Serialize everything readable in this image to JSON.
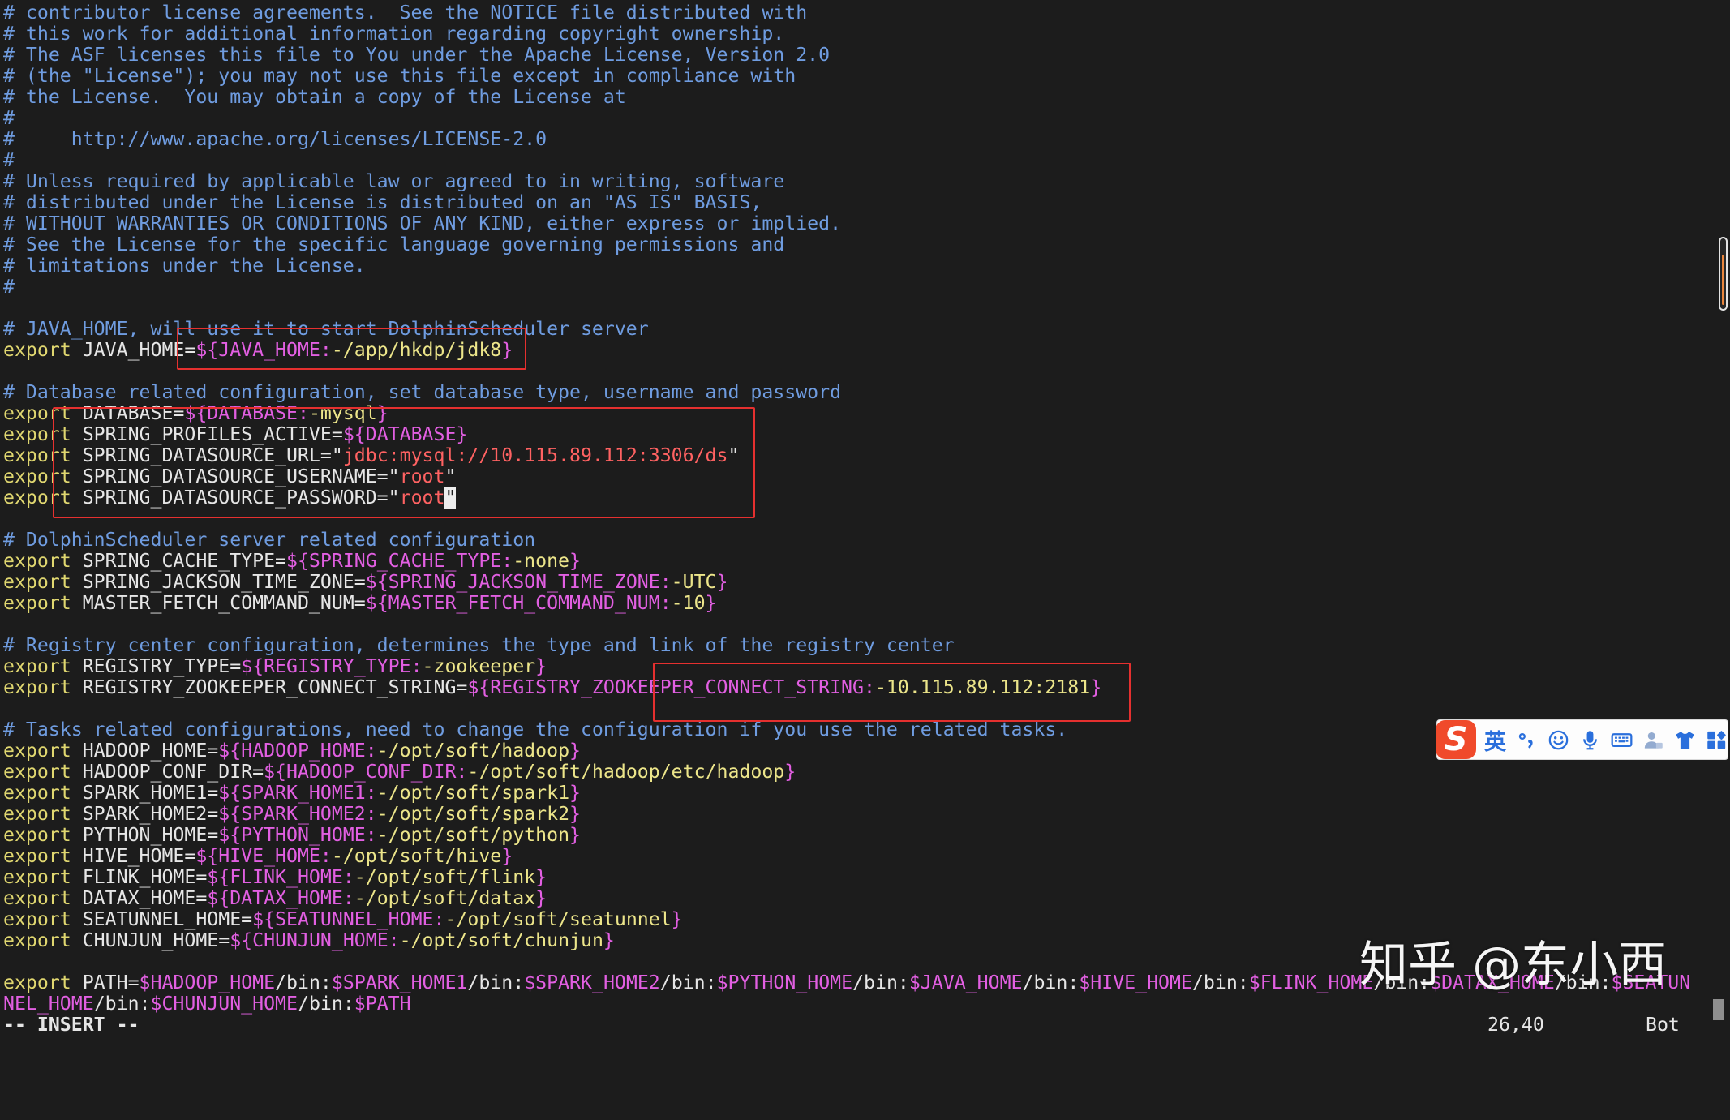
{
  "colors": {
    "background": "#1c1c1c",
    "comment": "#6f9ce0",
    "keyword": "#e0d770",
    "plain": "#e6e6e6",
    "deref": "#e25fe2",
    "default": "#ece58a",
    "string": "#ff6262",
    "cursor": "#ededed",
    "annotation": "#e5302f",
    "ime_icon": "#2a6fdc",
    "ime_logo": "#f04a2b",
    "scrollbar_accent": "#e9853c"
  },
  "editor": {
    "lines": [
      [
        [
          "#6f9ce0",
          "# contributor license agreements.  See the NOTICE file distributed with"
        ]
      ],
      [
        [
          "#6f9ce0",
          "# this work for additional information regarding copyright ownership."
        ]
      ],
      [
        [
          "#6f9ce0",
          "# The ASF licenses this file to You under the Apache License, Version 2.0"
        ]
      ],
      [
        [
          "#6f9ce0",
          "# (the \"License\"); you may not use this file except in compliance with"
        ]
      ],
      [
        [
          "#6f9ce0",
          "# the License.  You may obtain a copy of the License at"
        ]
      ],
      [
        [
          "#6f9ce0",
          "#"
        ]
      ],
      [
        [
          "#6f9ce0",
          "#     http://www.apache.org/licenses/LICENSE-2.0"
        ]
      ],
      [
        [
          "#6f9ce0",
          "#"
        ]
      ],
      [
        [
          "#6f9ce0",
          "# Unless required by applicable law or agreed to in writing, software"
        ]
      ],
      [
        [
          "#6f9ce0",
          "# distributed under the License is distributed on an \"AS IS\" BASIS,"
        ]
      ],
      [
        [
          "#6f9ce0",
          "# WITHOUT WARRANTIES OR CONDITIONS OF ANY KIND, either express or implied."
        ]
      ],
      [
        [
          "#6f9ce0",
          "# See the License for the specific language governing permissions and"
        ]
      ],
      [
        [
          "#6f9ce0",
          "# limitations under the License."
        ]
      ],
      [
        [
          "#6f9ce0",
          "#"
        ]
      ],
      [],
      [
        [
          "#6f9ce0",
          "# JAVA_HOME, will use it to start DolphinScheduler server"
        ]
      ],
      [
        [
          "#e0d770",
          "export"
        ],
        [
          "#e6e6e6",
          " JAVA_HOME="
        ],
        [
          "#e25fe2",
          "${JAVA_HOME:"
        ],
        [
          "#ece58a",
          "-/app/hkdp/jdk8"
        ],
        [
          "#e25fe2",
          "}"
        ]
      ],
      [],
      [
        [
          "#6f9ce0",
          "# Database related configuration, set database type, username and password"
        ]
      ],
      [
        [
          "#e0d770",
          "export"
        ],
        [
          "#e6e6e6",
          " DATABASE="
        ],
        [
          "#e25fe2",
          "${DATABASE:"
        ],
        [
          "#ece58a",
          "-mysql"
        ],
        [
          "#e25fe2",
          "}"
        ]
      ],
      [
        [
          "#e0d770",
          "export"
        ],
        [
          "#e6e6e6",
          " SPRING_PROFILES_ACTIVE="
        ],
        [
          "#e25fe2",
          "${DATABASE}"
        ]
      ],
      [
        [
          "#e0d770",
          "export"
        ],
        [
          "#e6e6e6",
          " SPRING_DATASOURCE_URL="
        ],
        [
          "#e6e6e6",
          "\""
        ],
        [
          "#ff6262",
          "jdbc:mysql://10.115.89.112:3306/ds"
        ],
        [
          "#e6e6e6",
          "\""
        ]
      ],
      [
        [
          "#e0d770",
          "export"
        ],
        [
          "#e6e6e6",
          " SPRING_DATASOURCE_USERNAME="
        ],
        [
          "#e6e6e6",
          "\""
        ],
        [
          "#ff6262",
          "root"
        ],
        [
          "#e6e6e6",
          "\""
        ]
      ],
      [
        [
          "#e0d770",
          "export"
        ],
        [
          "#e6e6e6",
          " SPRING_DATASOURCE_PASSWORD="
        ],
        [
          "#e6e6e6",
          "\""
        ],
        [
          "#ff6262",
          "root"
        ],
        [
          "#ededed",
          "\""
        ]
      ],
      [],
      [
        [
          "#6f9ce0",
          "# DolphinScheduler server related configuration"
        ]
      ],
      [
        [
          "#e0d770",
          "export"
        ],
        [
          "#e6e6e6",
          " SPRING_CACHE_TYPE="
        ],
        [
          "#e25fe2",
          "${SPRING_CACHE_TYPE:"
        ],
        [
          "#ece58a",
          "-none"
        ],
        [
          "#e25fe2",
          "}"
        ]
      ],
      [
        [
          "#e0d770",
          "export"
        ],
        [
          "#e6e6e6",
          " SPRING_JACKSON_TIME_ZONE="
        ],
        [
          "#e25fe2",
          "${SPRING_JACKSON_TIME_ZONE:"
        ],
        [
          "#ece58a",
          "-UTC"
        ],
        [
          "#e25fe2",
          "}"
        ]
      ],
      [
        [
          "#e0d770",
          "export"
        ],
        [
          "#e6e6e6",
          " MASTER_FETCH_COMMAND_NUM="
        ],
        [
          "#e25fe2",
          "${MASTER_FETCH_COMMAND_NUM:"
        ],
        [
          "#ece58a",
          "-10"
        ],
        [
          "#e25fe2",
          "}"
        ]
      ],
      [],
      [
        [
          "#6f9ce0",
          "# Registry center configuration, determines the type and link of the registry center"
        ]
      ],
      [
        [
          "#e0d770",
          "export"
        ],
        [
          "#e6e6e6",
          " REGISTRY_TYPE="
        ],
        [
          "#e25fe2",
          "${REGISTRY_TYPE:"
        ],
        [
          "#ece58a",
          "-zookeeper"
        ],
        [
          "#e25fe2",
          "}"
        ]
      ],
      [
        [
          "#e0d770",
          "export"
        ],
        [
          "#e6e6e6",
          " REGISTRY_ZOOKEEPER_CONNECT_STRING="
        ],
        [
          "#e25fe2",
          "${REGISTRY_ZOOKEEPER_CONNECT_STRING:"
        ],
        [
          "#ece58a",
          "-10.115.89.112:2181"
        ],
        [
          "#e25fe2",
          "}"
        ]
      ],
      [],
      [
        [
          "#6f9ce0",
          "# Tasks related configurations, need to change the configuration if you use the related tasks."
        ]
      ],
      [
        [
          "#e0d770",
          "export"
        ],
        [
          "#e6e6e6",
          " HADOOP_HOME="
        ],
        [
          "#e25fe2",
          "${HADOOP_HOME:"
        ],
        [
          "#ece58a",
          "-/opt/soft/hadoop"
        ],
        [
          "#e25fe2",
          "}"
        ]
      ],
      [
        [
          "#e0d770",
          "export"
        ],
        [
          "#e6e6e6",
          " HADOOP_CONF_DIR="
        ],
        [
          "#e25fe2",
          "${HADOOP_CONF_DIR:"
        ],
        [
          "#ece58a",
          "-/opt/soft/hadoop/etc/hadoop"
        ],
        [
          "#e25fe2",
          "}"
        ]
      ],
      [
        [
          "#e0d770",
          "export"
        ],
        [
          "#e6e6e6",
          " SPARK_HOME1="
        ],
        [
          "#e25fe2",
          "${SPARK_HOME1:"
        ],
        [
          "#ece58a",
          "-/opt/soft/spark1"
        ],
        [
          "#e25fe2",
          "}"
        ]
      ],
      [
        [
          "#e0d770",
          "export"
        ],
        [
          "#e6e6e6",
          " SPARK_HOME2="
        ],
        [
          "#e25fe2",
          "${SPARK_HOME2:"
        ],
        [
          "#ece58a",
          "-/opt/soft/spark2"
        ],
        [
          "#e25fe2",
          "}"
        ]
      ],
      [
        [
          "#e0d770",
          "export"
        ],
        [
          "#e6e6e6",
          " PYTHON_HOME="
        ],
        [
          "#e25fe2",
          "${PYTHON_HOME:"
        ],
        [
          "#ece58a",
          "-/opt/soft/python"
        ],
        [
          "#e25fe2",
          "}"
        ]
      ],
      [
        [
          "#e0d770",
          "export"
        ],
        [
          "#e6e6e6",
          " HIVE_HOME="
        ],
        [
          "#e25fe2",
          "${HIVE_HOME:"
        ],
        [
          "#ece58a",
          "-/opt/soft/hive"
        ],
        [
          "#e25fe2",
          "}"
        ]
      ],
      [
        [
          "#e0d770",
          "export"
        ],
        [
          "#e6e6e6",
          " FLINK_HOME="
        ],
        [
          "#e25fe2",
          "${FLINK_HOME:"
        ],
        [
          "#ece58a",
          "-/opt/soft/flink"
        ],
        [
          "#e25fe2",
          "}"
        ]
      ],
      [
        [
          "#e0d770",
          "export"
        ],
        [
          "#e6e6e6",
          " DATAX_HOME="
        ],
        [
          "#e25fe2",
          "${DATAX_HOME:"
        ],
        [
          "#ece58a",
          "-/opt/soft/datax"
        ],
        [
          "#e25fe2",
          "}"
        ]
      ],
      [
        [
          "#e0d770",
          "export"
        ],
        [
          "#e6e6e6",
          " SEATUNNEL_HOME="
        ],
        [
          "#e25fe2",
          "${SEATUNNEL_HOME:"
        ],
        [
          "#ece58a",
          "-/opt/soft/seatunnel"
        ],
        [
          "#e25fe2",
          "}"
        ]
      ],
      [
        [
          "#e0d770",
          "export"
        ],
        [
          "#e6e6e6",
          " CHUNJUN_HOME="
        ],
        [
          "#e25fe2",
          "${CHUNJUN_HOME:"
        ],
        [
          "#ece58a",
          "-/opt/soft/chunjun"
        ],
        [
          "#e25fe2",
          "}"
        ]
      ],
      [],
      [
        [
          "#e0d770",
          "export"
        ],
        [
          "#e6e6e6",
          " PATH="
        ],
        [
          "#e25fe2",
          "$HADOOP_HOME"
        ],
        [
          "#e6e6e6",
          "/bin:"
        ],
        [
          "#e25fe2",
          "$SPARK_HOME1"
        ],
        [
          "#e6e6e6",
          "/bin:"
        ],
        [
          "#e25fe2",
          "$SPARK_HOME2"
        ],
        [
          "#e6e6e6",
          "/bin:"
        ],
        [
          "#e25fe2",
          "$PYTHON_HOME"
        ],
        [
          "#e6e6e6",
          "/bin:"
        ],
        [
          "#e25fe2",
          "$JAVA_HOME"
        ],
        [
          "#e6e6e6",
          "/bin:"
        ],
        [
          "#e25fe2",
          "$HIVE_HOME"
        ],
        [
          "#e6e6e6",
          "/bin:"
        ],
        [
          "#e25fe2",
          "$FLINK_HOME"
        ],
        [
          "#e6e6e6",
          "/bin:"
        ],
        [
          "#e25fe2",
          "$DATAX_HOME"
        ],
        [
          "#e6e6e6",
          "/bin:"
        ],
        [
          "#e25fe2",
          "$SEATUN"
        ]
      ],
      [
        [
          "#e25fe2",
          "NEL_HOME"
        ],
        [
          "#e6e6e6",
          "/bin:"
        ],
        [
          "#e25fe2",
          "$CHUNJUN_HOME"
        ],
        [
          "#e6e6e6",
          "/bin:"
        ],
        [
          "#e25fe2",
          "$PATH"
        ]
      ]
    ]
  },
  "statusline": {
    "mode": "-- INSERT --",
    "position": "26,40",
    "scroll": "Bot"
  },
  "ime_toolbar": {
    "logo_letter": "S",
    "language_label": "英",
    "icons": [
      "punctuation-icon",
      "smiley-icon",
      "microphone-icon",
      "keyboard-icon",
      "user-icon",
      "skin-icon",
      "toolbox-icon"
    ]
  },
  "watermark": {
    "text": "知乎 @东小西"
  }
}
